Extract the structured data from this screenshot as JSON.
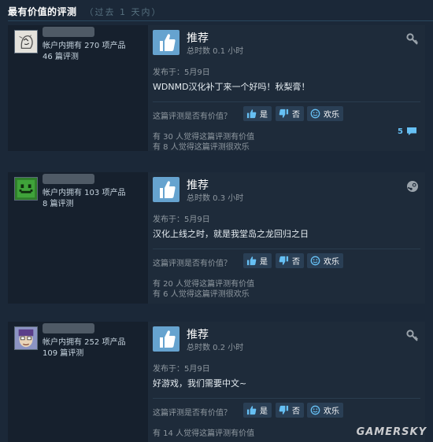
{
  "section": {
    "title": "最有价值的评测",
    "subtitle": "（过去 1 天内）"
  },
  "labels": {
    "helpful_question": "这篇评测是否有价值？",
    "yes": "是",
    "no": "否",
    "funny": "欢乐"
  },
  "colors": {
    "background": "#1b2838",
    "card": "#1e2b3a",
    "thumb_up": "#66a3cf",
    "link": "#66c0f4"
  },
  "reviews": [
    {
      "products_owned": "帐户内拥有 270 项产品",
      "review_count": "46 篇评测",
      "verdict": "推荐",
      "hours": "总时数 0.1 小时",
      "posted": "发布于：5月9日",
      "text": "WDNMD汉化补丁来一个好吗！秋梨膏！",
      "helpful_stat": "有 30 人觉得这篇评测有价值",
      "funny_stat": "有 8 人觉得这篇评测很欢乐",
      "comment_count": "5",
      "source_icon": "key-icon"
    },
    {
      "products_owned": "帐户内拥有 103 项产品",
      "review_count": "8 篇评测",
      "verdict": "推荐",
      "hours": "总时数 0.3 小时",
      "posted": "发布于：5月9日",
      "text": "汉化上线之时，就是我堂岛之龙回归之日",
      "helpful_stat": "有 20 人觉得这篇评测有价值",
      "funny_stat": "有 6 人觉得这篇评测很欢乐",
      "source_icon": "steam-icon"
    },
    {
      "products_owned": "帐户内拥有 252 项产品",
      "review_count": "109 篇评测",
      "verdict": "推荐",
      "hours": "总时数 0.2 小时",
      "posted": "发布于：5月9日",
      "text": "好游戏，我们需要中文~",
      "helpful_stat": "有 14 人觉得这篇评测有价值",
      "source_icon": "key-icon"
    }
  ],
  "watermark": "GAMERSKY"
}
